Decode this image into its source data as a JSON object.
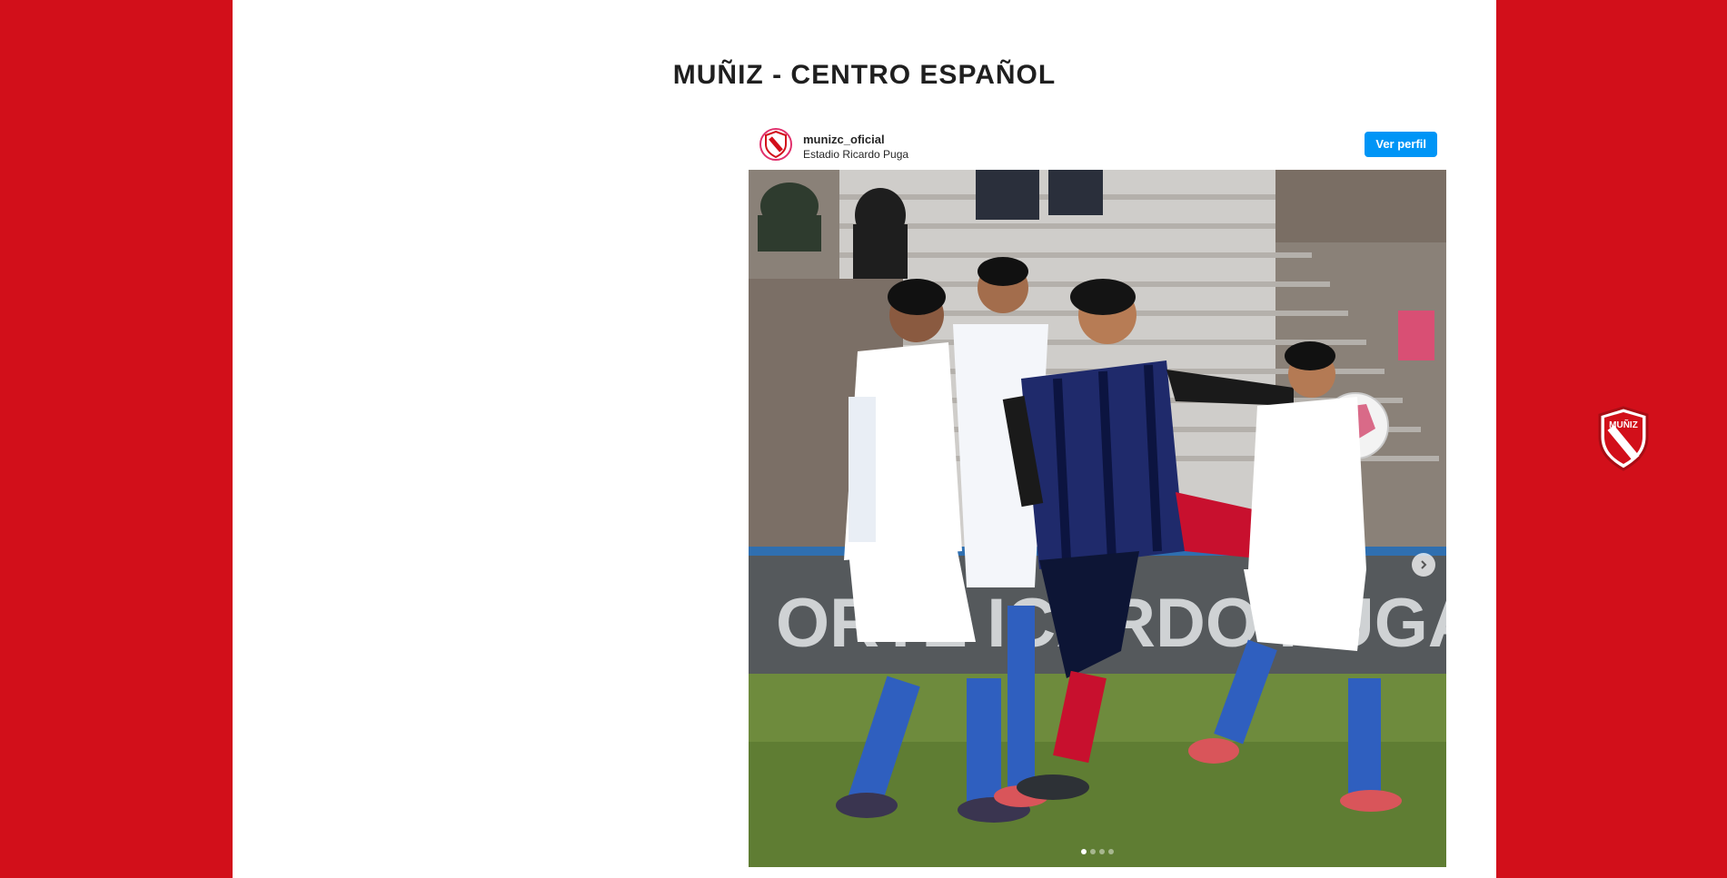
{
  "page": {
    "title": "MUÑIZ - CENTRO ESPAÑOL",
    "background_color": "#d20f1a",
    "panel_color": "#ffffff"
  },
  "instagram_embed": {
    "username": "munizc_oficial",
    "location": "Estadio Ricardo Puga",
    "profile_button_label": "Ver perfil",
    "button_color": "#0095f6",
    "carousel": {
      "slide_count": 4,
      "active_index": 0,
      "next_icon": "chevron-right-icon"
    },
    "photo": {
      "banner_text": "ORTE     ICARDO PUGA",
      "home_jersey_colors": [
        "#1f2a6b",
        "#c8102e"
      ],
      "away_jersey_colors": [
        "#ffffff",
        "#2f6fd1"
      ]
    }
  },
  "side_crest": {
    "text": "MUÑIZ",
    "icon": "club-crest-icon"
  }
}
